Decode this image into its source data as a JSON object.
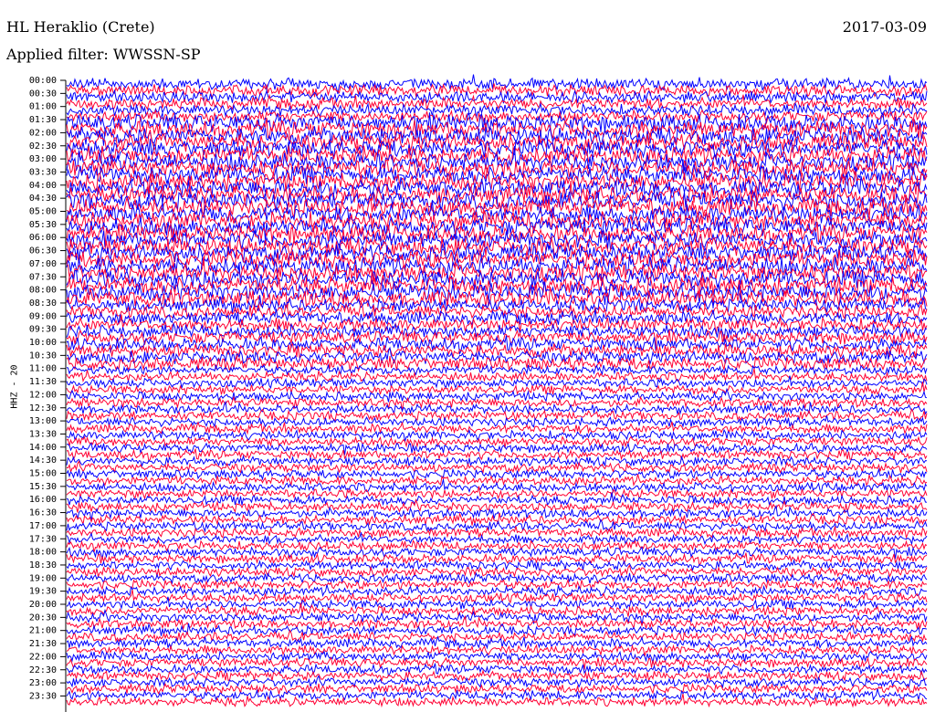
{
  "header": {
    "station": "HL Heraklio (Crete)",
    "date": "2017-03-09",
    "filter": "Applied filter: WWSSN-SP"
  },
  "chart_data": {
    "type": "line",
    "title": "HL Heraklio (Crete)",
    "ylabel": "HHZ - 20",
    "xlabel": "",
    "row_labels": [
      "00:00",
      "00:30",
      "01:00",
      "01:30",
      "02:00",
      "02:30",
      "03:00",
      "03:30",
      "04:00",
      "04:30",
      "05:00",
      "05:30",
      "06:00",
      "06:30",
      "07:00",
      "07:30",
      "08:00",
      "08:30",
      "09:00",
      "09:30",
      "10:00",
      "10:30",
      "11:00",
      "11:30",
      "12:00",
      "12:30",
      "13:00",
      "13:30",
      "14:00",
      "14:30",
      "15:00",
      "15:30",
      "16:00",
      "16:30",
      "17:00",
      "17:30",
      "18:00",
      "18:30",
      "19:00",
      "19:30",
      "20:00",
      "20:30",
      "21:00",
      "21:30",
      "22:00",
      "22:30",
      "23:00",
      "23:30"
    ],
    "series_colors": [
      "#0000ff",
      "#ff0033"
    ],
    "description_of_values": "continuous seismic waveform traces, one per 15-minute row; amplitudes not labeled",
    "grid": false
  }
}
